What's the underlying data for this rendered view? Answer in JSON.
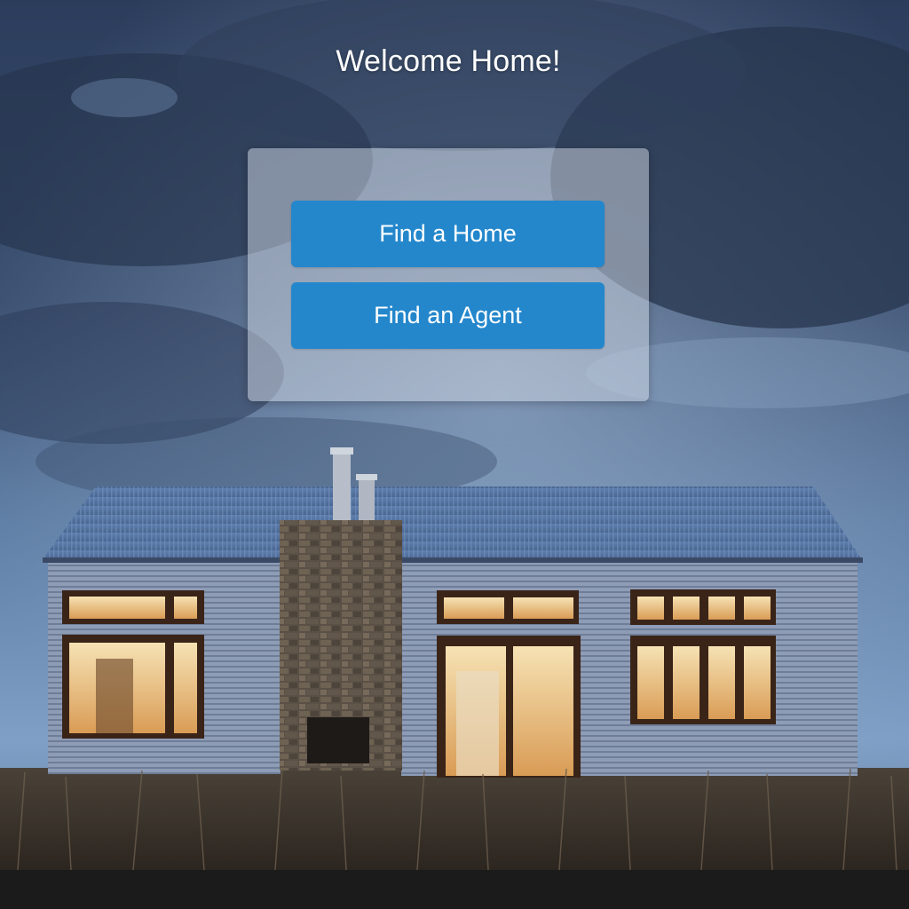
{
  "page": {
    "title": "Welcome Home!"
  },
  "actions": {
    "find_home_label": "Find a Home",
    "find_agent_label": "Find an Agent"
  },
  "colors": {
    "button": "#2487cc",
    "panel": "rgba(205,212,225,0.52)",
    "footer": "#1b1b1b"
  },
  "background": {
    "image": "house-at-dusk-photo"
  }
}
